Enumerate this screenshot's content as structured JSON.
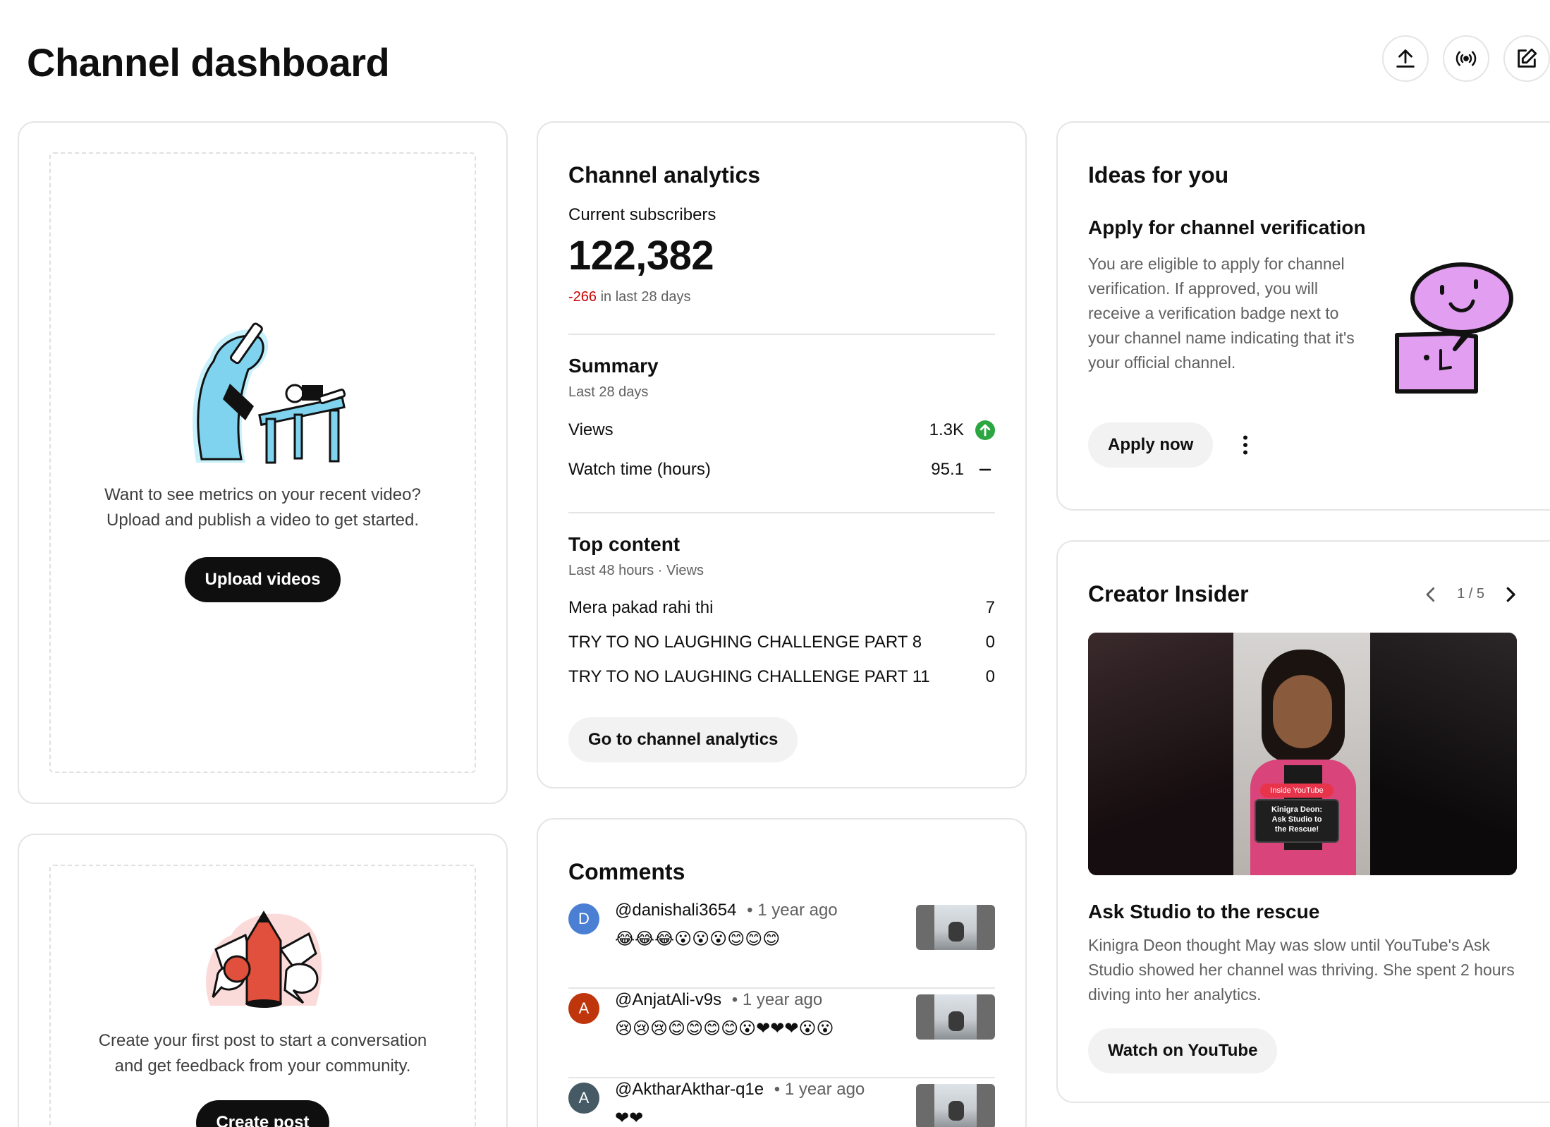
{
  "header": {
    "title": "Channel dashboard",
    "actions": [
      {
        "icon": "upload-icon"
      },
      {
        "icon": "live-icon"
      },
      {
        "icon": "edit-icon"
      }
    ]
  },
  "video_card": {
    "text_line1": "Want to see metrics on your recent video?",
    "text_line2": "Upload and publish a video to get started.",
    "button": "Upload videos"
  },
  "post_card": {
    "text_line1": "Create your first post to start a conversation",
    "text_line2": "and get feedback from your community.",
    "button": "Create post"
  },
  "analytics": {
    "title": "Channel analytics",
    "subs_label": "Current subscribers",
    "subs_value": "122,382",
    "subs_change": "-266",
    "subs_change_suffix": "in last 28 days",
    "summary_title": "Summary",
    "summary_sub": "Last 28 days",
    "summary_rows": [
      {
        "label": "Views",
        "value": "1.3K",
        "indicator": "up-arrow-icon"
      },
      {
        "label": "Watch time (hours)",
        "value": "95.1",
        "indicator": "dash-icon"
      }
    ],
    "top_title": "Top content",
    "top_sub": "Last 48 hours · Views",
    "top_rows": [
      {
        "label": "Mera pakad rahi thi",
        "value": "7"
      },
      {
        "label": "TRY TO NO LAUGHING CHALLENGE PART 8",
        "value": "0"
      },
      {
        "label": "TRY TO NO LAUGHING CHALLENGE PART 11",
        "value": "0"
      }
    ],
    "button": "Go to channel analytics"
  },
  "comments": {
    "title": "Comments",
    "items": [
      {
        "initial": "D",
        "color": "#4a7fd4",
        "user": "@danishali3654",
        "time": "• 1 year ago",
        "text": "😂😂😂😮😮😮😊😊😊"
      },
      {
        "initial": "A",
        "color": "#bf360c",
        "user": "@AnjatAli-v9s",
        "time": "• 1 year ago",
        "text": "😢😢😢😊😊😊😊😮❤❤❤😮😮"
      },
      {
        "initial": "A",
        "color": "#455a64",
        "user": "@AktharAkthar-q1e",
        "time": "• 1 year ago",
        "text": "❤❤"
      }
    ]
  },
  "ideas": {
    "title": "Ideas for you",
    "item_title": "Apply for channel verification",
    "item_text": "You are eligible to apply for channel verification. If approved, you will receive a verification badge next to your channel name indicating that it's your official channel.",
    "button": "Apply now"
  },
  "insider": {
    "title": "Creator Insider",
    "pager": "1 / 5",
    "thumb_tag": "Inside YouTube",
    "thumb_caption_1": "Kinigra Deon:",
    "thumb_caption_2": "Ask Studio to",
    "thumb_caption_3": "the Rescue!",
    "video_title": "Ask Studio to the rescue",
    "video_text": "Kinigra Deon thought May was slow until YouTube's Ask Studio showed her channel was thriving. She spent 2 hours diving into her analytics.",
    "button": "Watch on YouTube"
  },
  "colors": {
    "negative": "#cc0000",
    "positive": "#2ba640",
    "accent": "#0f0f0f"
  }
}
